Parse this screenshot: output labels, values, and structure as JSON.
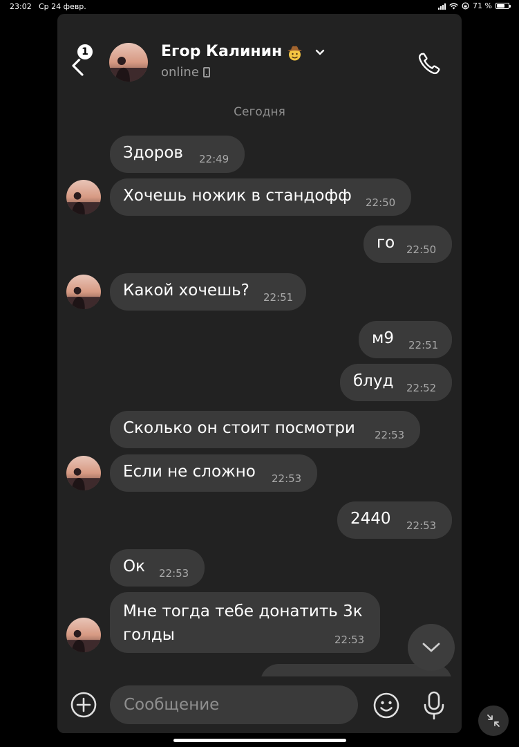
{
  "status_bar": {
    "time": "23:02",
    "date": "Ср 24 февр.",
    "battery_percent": "71 %",
    "battery_level": 0.71
  },
  "header": {
    "unread_count": "1",
    "contact_name": "Егор Калинин",
    "contact_status": "online",
    "name_emoji_icon": "cowboy-face-icon",
    "call_icon": "phone-call-icon"
  },
  "chat": {
    "date_separator": "Сегодня",
    "messages": [
      {
        "text": "Здоров",
        "time": "22:49",
        "outgoing": false
      },
      {
        "text": "Хочешь ножик в стандофф",
        "time": "22:50",
        "outgoing": false
      },
      {
        "text": "го",
        "time": "22:50",
        "outgoing": true
      },
      {
        "text": "Какой хочешь?",
        "time": "22:51",
        "outgoing": false
      },
      {
        "text": "м9",
        "time": "22:51",
        "outgoing": true
      },
      {
        "text": "блуд",
        "time": "22:52",
        "outgoing": true
      },
      {
        "text": "Сколько он стоит посмотри",
        "time": "22:53",
        "outgoing": false
      },
      {
        "text": "Если не сложно",
        "time": "22:53",
        "outgoing": false
      },
      {
        "text": "2440",
        "time": "22:53",
        "outgoing": true
      },
      {
        "text": "Ок",
        "time": "22:53",
        "outgoing": false
      },
      {
        "text_line1": "Мне тогда тебе донатить 3к",
        "text_line2": "голды",
        "time": "22:53",
        "outgoing": false
      }
    ]
  },
  "composer": {
    "placeholder": "Сообщение",
    "attach_icon": "plus-circle-icon",
    "sticker_icon": "smiley-icon",
    "mic_icon": "microphone-icon"
  },
  "colors": {
    "background": "#000000",
    "panel": "#222222",
    "bubble": "#3a3a3a",
    "muted_text": "#8e8e8e"
  }
}
